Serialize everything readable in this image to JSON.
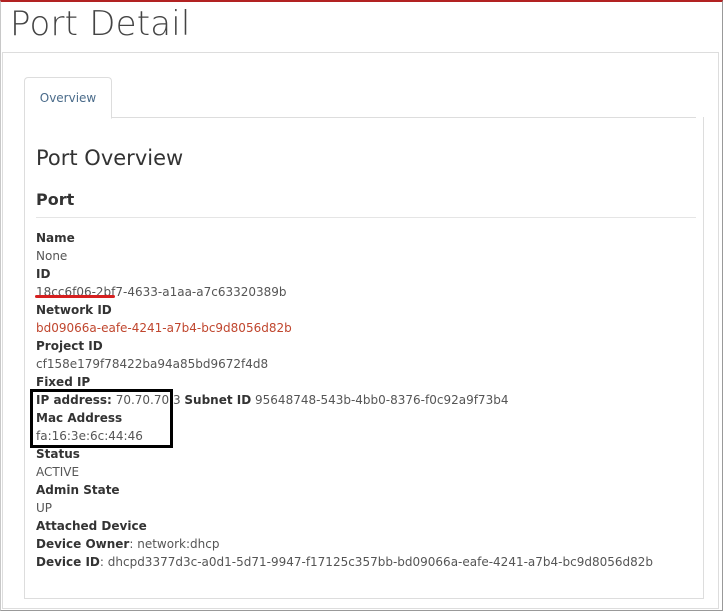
{
  "page": {
    "title": "Port Detail"
  },
  "tabs": [
    {
      "label": "Overview",
      "active": true
    }
  ],
  "overview": {
    "title": "Port Overview",
    "section": "Port"
  },
  "fields": {
    "name_label": "Name",
    "name_value": "None",
    "id_label": "ID",
    "id_value": "18cc6f06-2bf7-4633-a1aa-a7c63320389b",
    "network_id_label": "Network ID",
    "network_id_value": "bd09066a-eafe-4241-a7b4-bc9d8056d82b",
    "project_id_label": "Project ID",
    "project_id_value": "cf158e179f78422ba94a85bd9672f4d8",
    "fixed_ip_label": "Fixed IP",
    "ip_address_label": "IP address:",
    "ip_address_value": "70.70.70.3",
    "subnet_id_label": "Subnet ID",
    "subnet_id_value": "95648748-543b-4bb0-8376-f0c92a9f73b4",
    "mac_address_label": "Mac Address",
    "mac_address_value": "fa:16:3e:6c:44:46",
    "status_label": "Status",
    "status_value": "ACTIVE",
    "admin_state_label": "Admin State",
    "admin_state_value": "UP",
    "attached_device_label": "Attached Device",
    "device_owner_label": "Device Owner",
    "device_owner_value": "network:dhcp",
    "device_id_label": "Device ID",
    "device_id_value": "dhcpd3377d3c-a0d1-5d71-9947-f17125c357bb-bd09066a-eafe-4241-a7b4-bc9d8056d82b"
  },
  "annotations": {
    "underline_color": "#d62020",
    "box_color": "#000000"
  }
}
